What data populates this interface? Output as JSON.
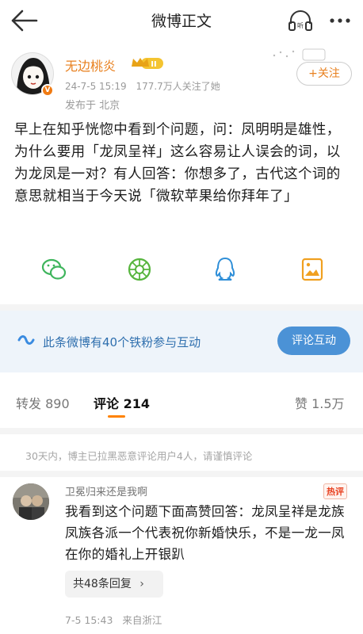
{
  "header": {
    "title": "微博正文",
    "listen_icon_label": "听",
    "icons": [
      "back-arrow-icon",
      "listen-icon",
      "more-icon"
    ]
  },
  "author": {
    "name": "无边桃炎",
    "level_badge": "II",
    "date": "24-7-5 15:19",
    "followers": "177.7万人关注了她",
    "location": "发布于 北京",
    "follow_label": "+关注",
    "name_color": "#e8801f"
  },
  "post": {
    "text": "早上在知乎恍惚中看到个问题，问：凤明明是雄性，为什么要用「龙凤呈祥」这么容易让人误会的词，以为龙凤是一对？有人回答：你想多了，古代这个词的意思就相当于今天说「微软苹果给你拜年了」"
  },
  "share": {
    "icons": [
      "wechat-icon",
      "moments-icon",
      "qq-icon",
      "save-image-icon"
    ]
  },
  "fans_banner": {
    "text": "此条微博有40个铁粉参与互动",
    "button_label": "评论互动",
    "accent": "#4b92d6"
  },
  "tabs": {
    "repost_label": "转发",
    "repost_count": "890",
    "comment_label": "评论",
    "comment_count": "214",
    "like_label": "赞",
    "like_count": "1.5万",
    "accent": "#ff8200"
  },
  "notice": {
    "text": "30天内，博主已拉黑恶意评论用户4人，请谨慎评论"
  },
  "comment": {
    "username": "卫冕归来还是我啊",
    "tag": "热评",
    "text": "我看到这个问题下面高赞回答：龙凤呈祥是龙族凤族各派一个代表祝你新婚快乐，不是一龙一凤在你的婚礼上开银趴",
    "replies_label": "共48条回复",
    "time": "7-5 15:43",
    "source": "来自浙江"
  }
}
